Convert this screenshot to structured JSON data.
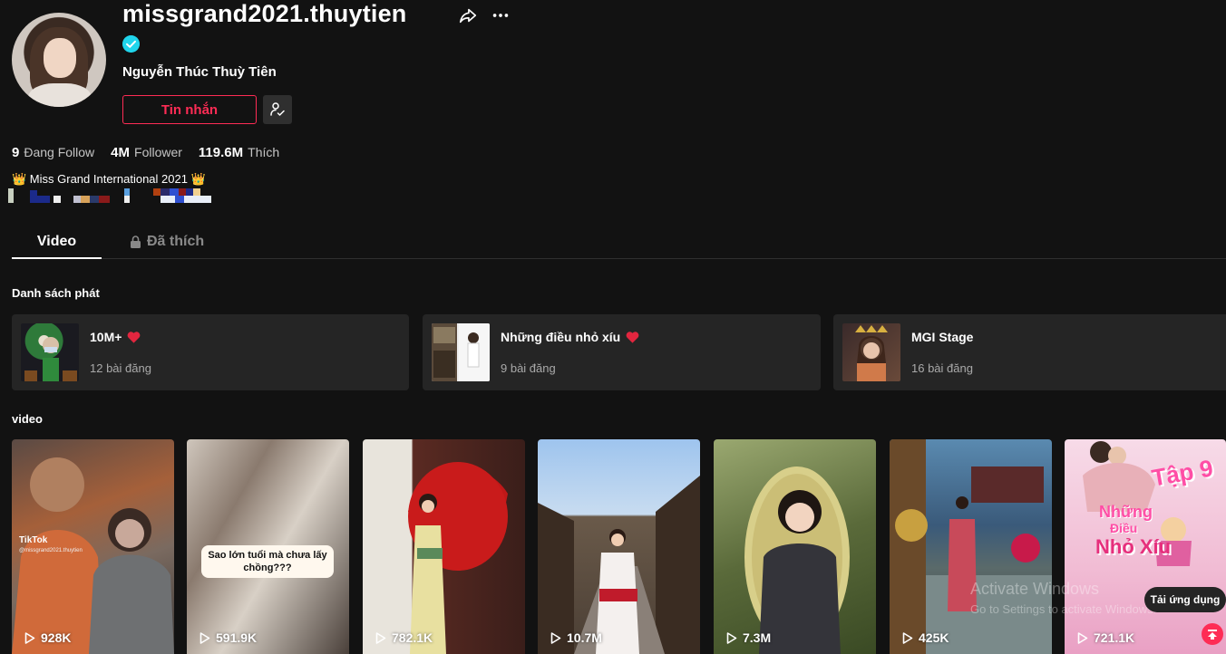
{
  "profile": {
    "username": "missgrand2021.thuytien",
    "nickname": "Nguyễn Thúc Thuỳ Tiên",
    "message_button": "Tin nhắn",
    "stats": [
      {
        "value": "9",
        "label": "Đang Follow"
      },
      {
        "value": "4M",
        "label": "Follower"
      },
      {
        "value": "119.6M",
        "label": "Thích"
      }
    ],
    "bio": "👑 Miss Grand International 2021 👑"
  },
  "tabs": [
    {
      "label": "Video"
    },
    {
      "label": "Đã thích"
    }
  ],
  "playlists": {
    "title": "Danh sách phát",
    "items": [
      {
        "name": "10M+",
        "count": "12 bài đăng"
      },
      {
        "name": "Những điều nhỏ xíu",
        "count": "9 bài đăng"
      },
      {
        "name": "MGI Stage",
        "count": "16 bài đăng"
      }
    ]
  },
  "videos": {
    "title": "video",
    "items": [
      {
        "views": "928K",
        "watermark": "TikTok",
        "watermark_handle": "@missgrand2021.thuytien"
      },
      {
        "views": "591.9K",
        "caption": "Sao lớn tuổi mà chưa lấy chồng???"
      },
      {
        "views": "782.1K"
      },
      {
        "views": "10.7M"
      },
      {
        "views": "7.3M"
      },
      {
        "views": "425K"
      },
      {
        "views": "721.1K",
        "title_tap": "Tập 9",
        "title_line1": "Những",
        "title_line2": "Điều",
        "title_line3": "Nhỏ Xíu"
      }
    ]
  },
  "os_watermark": {
    "line1": "Activate Windows",
    "line2": "Go to Settings to activate Windows."
  },
  "download_app": "Tải ứng dụng",
  "colors": {
    "background": "#121212",
    "accent": "#fe2c55",
    "verified": "#20d5ec",
    "card": "#252525"
  }
}
